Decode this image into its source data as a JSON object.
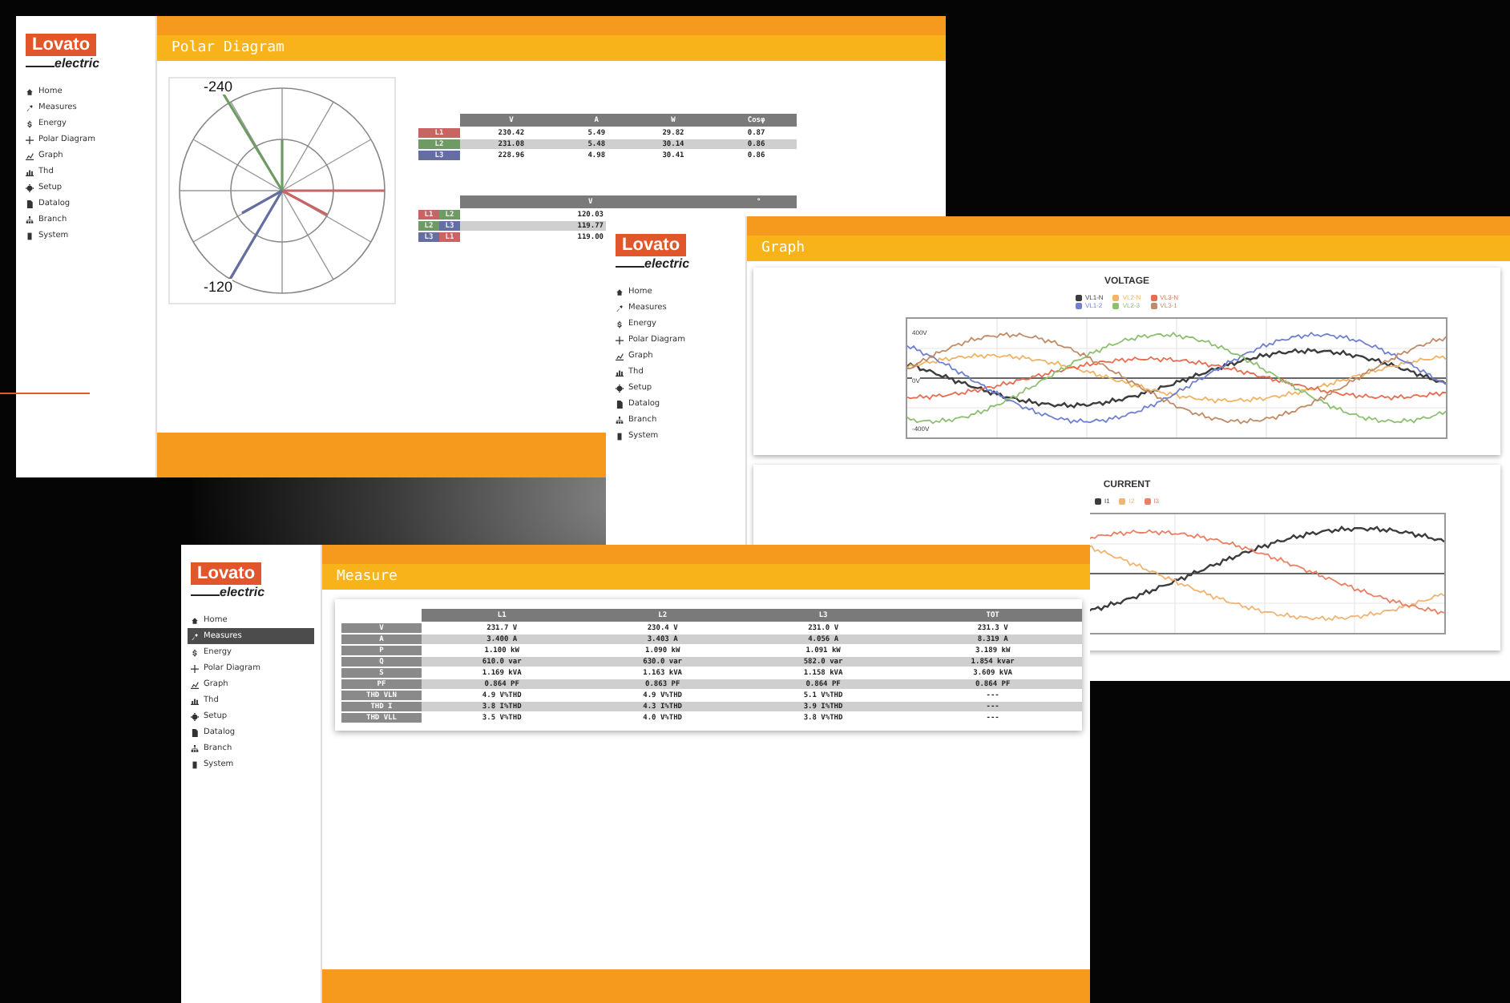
{
  "windows": [
    {
      "kind": "polar",
      "logo": {
        "brand": "Lovato",
        "sub": "electric"
      },
      "title": "Polar Diagram",
      "sidebar": [
        {
          "label": "Home",
          "selected": false
        },
        {
          "label": "Measures",
          "selected": false
        },
        {
          "label": "Energy",
          "selected": false
        },
        {
          "label": "Polar Diagram",
          "selected": false
        },
        {
          "label": "Graph",
          "selected": false
        },
        {
          "label": "Thd",
          "selected": false
        },
        {
          "label": "Setup",
          "selected": false
        },
        {
          "label": "Datalog",
          "selected": false
        },
        {
          "label": "Branch",
          "selected": false
        },
        {
          "label": "System",
          "selected": false
        }
      ],
      "polar_labels": [
        "-240",
        "-120"
      ],
      "phase_table": {
        "columns": [
          "V",
          "A",
          "W",
          "Cosφ"
        ],
        "rows": [
          {
            "label": "L1",
            "color": "#c86464",
            "cells": [
              "230.42",
              "5.49",
              "29.82",
              "0.87"
            ]
          },
          {
            "label": "L2",
            "color": "#6e9a64",
            "cells": [
              "231.08",
              "5.48",
              "30.14",
              "0.86"
            ]
          },
          {
            "label": "L3",
            "color": "#646ea0",
            "cells": [
              "228.96",
              "4.98",
              "30.41",
              "0.86"
            ]
          }
        ]
      },
      "line_table": {
        "columns": [
          "V",
          "°"
        ],
        "rows": [
          {
            "labels": [
              {
                "text": "L1",
                "color": "#c86464"
              },
              {
                "text": "L2",
                "color": "#6e9a64"
              }
            ],
            "cells": [
              "120.03"
            ]
          },
          {
            "labels": [
              {
                "text": "L2",
                "color": "#6e9a64"
              },
              {
                "text": "L3",
                "color": "#646ea0"
              }
            ],
            "cells": [
              "119.77"
            ]
          },
          {
            "labels": [
              {
                "text": "L3",
                "color": "#646ea0"
              },
              {
                "text": "L1",
                "color": "#c86464"
              }
            ],
            "cells": [
              "119.00"
            ]
          }
        ]
      }
    },
    {
      "kind": "graph",
      "logo": {
        "brand": "Lovato",
        "sub": "electric"
      },
      "title": "Graph",
      "sidebar": [
        {
          "label": "Home",
          "selected": false
        },
        {
          "label": "Measures",
          "selected": false
        },
        {
          "label": "Energy",
          "selected": false
        },
        {
          "label": "Polar Diagram",
          "selected": false
        },
        {
          "label": "Graph",
          "selected": false
        },
        {
          "label": "Thd",
          "selected": false
        },
        {
          "label": "Setup",
          "selected": false
        },
        {
          "label": "Datalog",
          "selected": false
        },
        {
          "label": "Branch",
          "selected": false
        },
        {
          "label": "System",
          "selected": false
        }
      ],
      "charts": [
        {
          "title": "VOLTAGE",
          "y_labels": [
            "400V",
            "0V",
            "-400V"
          ],
          "legend": [
            {
              "label": "VL1-N",
              "color": "#3c3c3c"
            },
            {
              "label": "VL2-N",
              "color": "#f0b464"
            },
            {
              "label": "VL3-N",
              "color": "#e86c50"
            },
            {
              "label": "VL1-2",
              "color": "#7080d0"
            },
            {
              "label": "VL2-3",
              "color": "#8cc070"
            },
            {
              "label": "VL3-1",
              "color": "#c08c68"
            }
          ]
        },
        {
          "title": "CURRENT",
          "legend": [
            {
              "label": "I1",
              "color": "#3c3c3c"
            },
            {
              "label": "I2",
              "color": "#f0b474"
            },
            {
              "label": "I3",
              "color": "#e88064"
            }
          ]
        }
      ]
    },
    {
      "kind": "measure",
      "logo": {
        "brand": "Lovato",
        "sub": "electric"
      },
      "title": "Measure",
      "sidebar": [
        {
          "label": "Home",
          "selected": false
        },
        {
          "label": "Measures",
          "selected": true
        },
        {
          "label": "Energy",
          "selected": false
        },
        {
          "label": "Polar Diagram",
          "selected": false
        },
        {
          "label": "Graph",
          "selected": false
        },
        {
          "label": "Thd",
          "selected": false
        },
        {
          "label": "Setup",
          "selected": false
        },
        {
          "label": "Datalog",
          "selected": false
        },
        {
          "label": "Branch",
          "selected": false
        },
        {
          "label": "System",
          "selected": false
        }
      ],
      "table": {
        "columns": [
          "L1",
          "L2",
          "L3",
          "TOT"
        ],
        "rows": [
          {
            "label": "V",
            "cells": [
              "231.7 V",
              "230.4 V",
              "231.0 V",
              "231.3 V"
            ]
          },
          {
            "label": "A",
            "cells": [
              "3.400 A",
              "3.403 A",
              "4.056 A",
              "8.319 A"
            ]
          },
          {
            "label": "P",
            "cells": [
              "1.100 kW",
              "1.090 kW",
              "1.091 kW",
              "3.189 kW"
            ]
          },
          {
            "label": "Q",
            "cells": [
              "610.0 var",
              "630.0 var",
              "582.0 var",
              "1.854 kvar"
            ]
          },
          {
            "label": "S",
            "cells": [
              "1.169 kVA",
              "1.163 kVA",
              "1.158 kVA",
              "3.609 kVA"
            ]
          },
          {
            "label": "PF",
            "cells": [
              "0.864 PF",
              "0.863 PF",
              "0.864 PF",
              "0.864 PF"
            ]
          },
          {
            "label": "THD VLN",
            "cells": [
              "4.9 V%THD",
              "4.9 V%THD",
              "5.1 V%THD",
              "---"
            ]
          },
          {
            "label": "THD I",
            "cells": [
              "3.8 I%THD",
              "4.3 I%THD",
              "3.9 I%THD",
              "---"
            ]
          },
          {
            "label": "THD VLL",
            "cells": [
              "3.5 V%THD",
              "4.0 V%THD",
              "3.8 V%THD",
              "---"
            ]
          }
        ]
      }
    }
  ]
}
